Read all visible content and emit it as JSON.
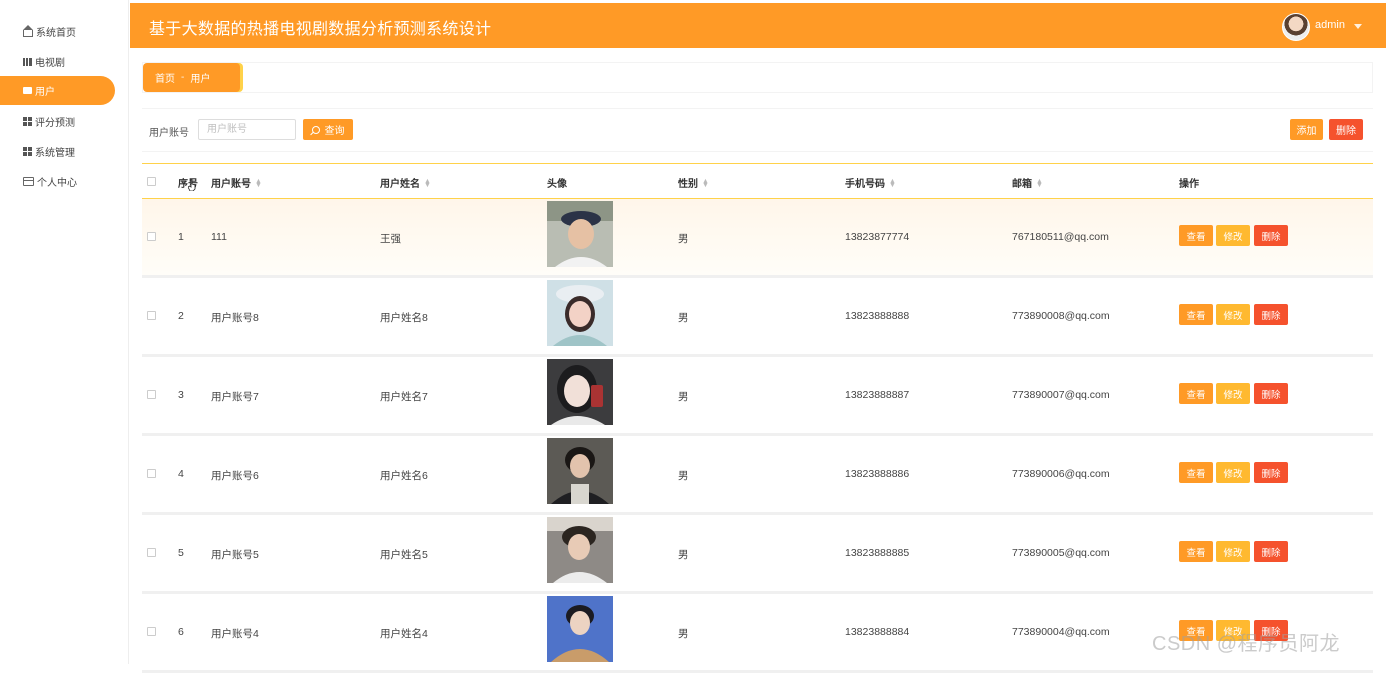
{
  "app": {
    "title": "基于大数据的热播电视剧数据分析预测系统设计",
    "user": "admin"
  },
  "sidebar": {
    "items": [
      {
        "label": "系统首页",
        "icon": "home-icon"
      },
      {
        "label": "电视剧",
        "icon": "book-icon"
      },
      {
        "label": "用户",
        "icon": "chat-icon",
        "active": true
      },
      {
        "label": "评分预测",
        "icon": "grid-icon"
      },
      {
        "label": "系统管理",
        "icon": "grid-icon"
      },
      {
        "label": "个人中心",
        "icon": "card-icon"
      }
    ]
  },
  "breadcrumb": {
    "home": "首页",
    "separator": "-",
    "current": "用户"
  },
  "search": {
    "label": "用户账号",
    "placeholder": "用户账号",
    "query_label": "查询",
    "add_label": "添加",
    "delete_label": "删除"
  },
  "table": {
    "headers": [
      "序号",
      "用户账号",
      "用户姓名",
      "头像",
      "性别",
      "手机号码",
      "邮箱",
      "操作"
    ],
    "action_labels": {
      "view": "查看",
      "edit": "修改",
      "delete": "删除"
    },
    "rows": [
      {
        "index": "1",
        "account": "111",
        "name": "王强",
        "gender": "男",
        "phone": "13823877774",
        "email": "767180511@qq.com"
      },
      {
        "index": "2",
        "account": "用户账号8",
        "name": "用户姓名8",
        "gender": "男",
        "phone": "13823888888",
        "email": "773890008@qq.com"
      },
      {
        "index": "3",
        "account": "用户账号7",
        "name": "用户姓名7",
        "gender": "男",
        "phone": "13823888887",
        "email": "773890007@qq.com"
      },
      {
        "index": "4",
        "account": "用户账号6",
        "name": "用户姓名6",
        "gender": "男",
        "phone": "13823888886",
        "email": "773890006@qq.com"
      },
      {
        "index": "5",
        "account": "用户账号5",
        "name": "用户姓名5",
        "gender": "男",
        "phone": "13823888885",
        "email": "773890005@qq.com"
      },
      {
        "index": "6",
        "account": "用户账号4",
        "name": "用户姓名4",
        "gender": "男",
        "phone": "13823888884",
        "email": "773890004@qq.com"
      }
    ]
  },
  "watermark": "CSDN @程序员阿龙",
  "colors": {
    "accent": "#ff9a26",
    "danger": "#f5522d",
    "edit": "#ffb930"
  }
}
